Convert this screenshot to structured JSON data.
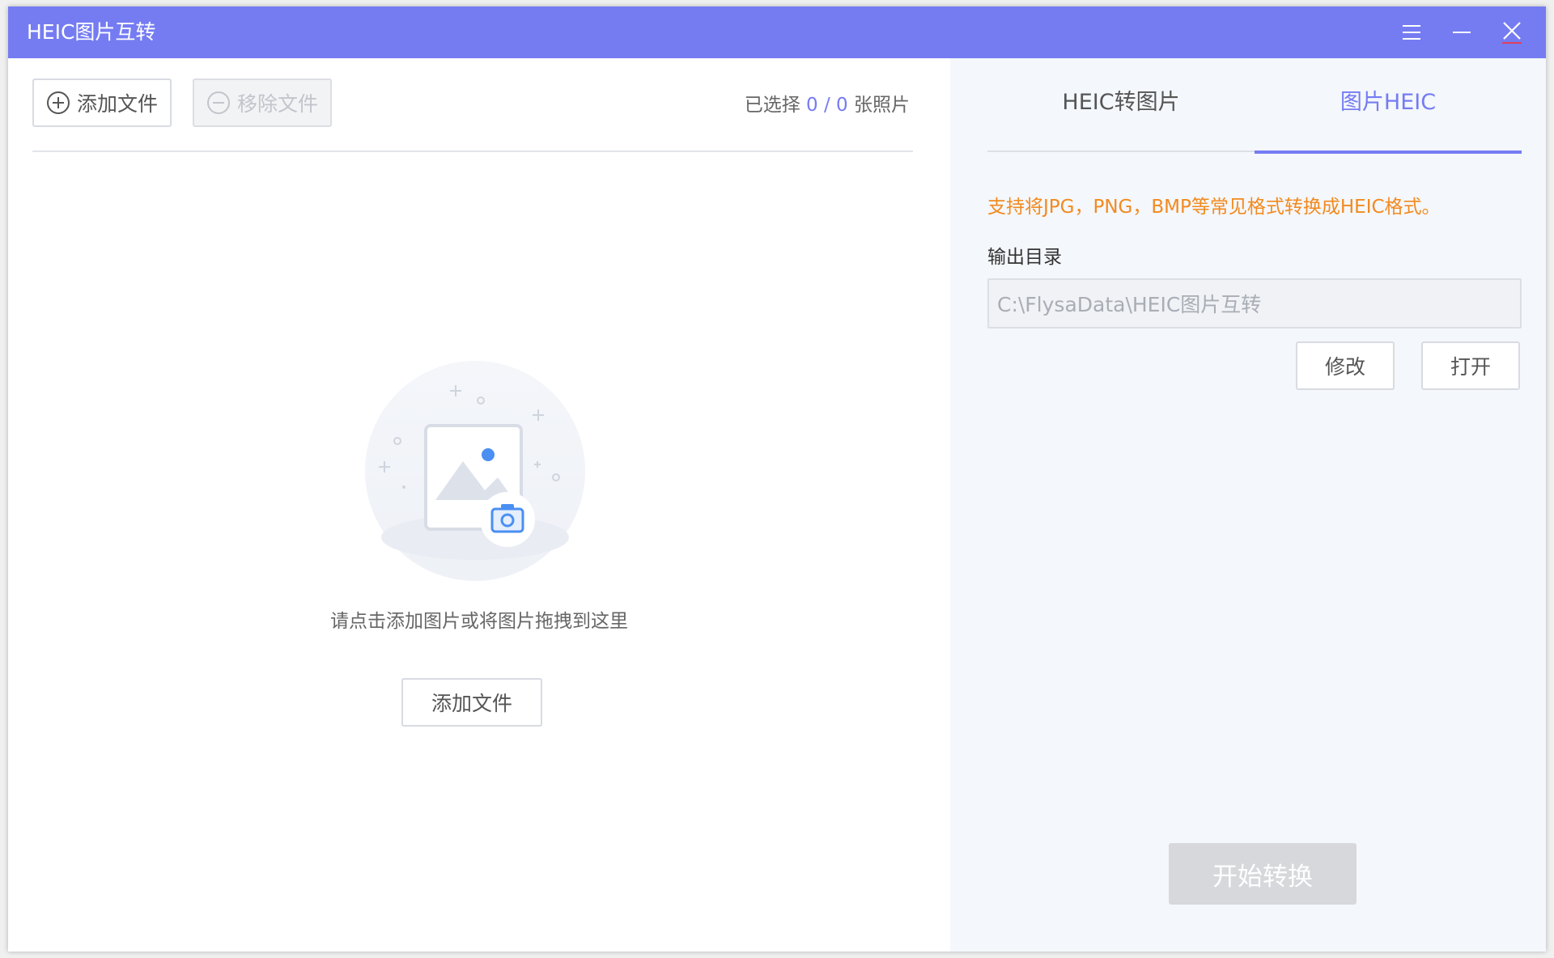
{
  "app": {
    "title": "HEIC图片互转"
  },
  "toolbar": {
    "add_label": "添加文件",
    "remove_label": "移除文件"
  },
  "selection": {
    "prefix": "已选择",
    "selected": "0",
    "separator": "/",
    "total": "0",
    "suffix": "张照片"
  },
  "empty_state": {
    "message": "请点击添加图片或将图片拖拽到这里",
    "add_label": "添加文件"
  },
  "tabs": [
    {
      "label": "HEIC转图片",
      "active": false
    },
    {
      "label": "图片HEIC",
      "active": true
    }
  ],
  "settings": {
    "notice": "支持将JPG，PNG，BMP等常见格式转换成HEIC格式。",
    "output_label": "输出目录",
    "output_path": "C:\\FlysaData\\HEIC图片互转",
    "modify_label": "修改",
    "open_label": "打开",
    "start_label": "开始转换"
  },
  "icons": {
    "menu": "menu-icon",
    "minimize": "minimize-icon",
    "close": "close-icon",
    "add": "plus-circle-icon",
    "remove": "minus-circle-icon",
    "illustration": "image-camera-icon"
  },
  "colors": {
    "accent": "#757cf2",
    "notice": "#f28a1f",
    "disabled": "#d6d8dc"
  }
}
